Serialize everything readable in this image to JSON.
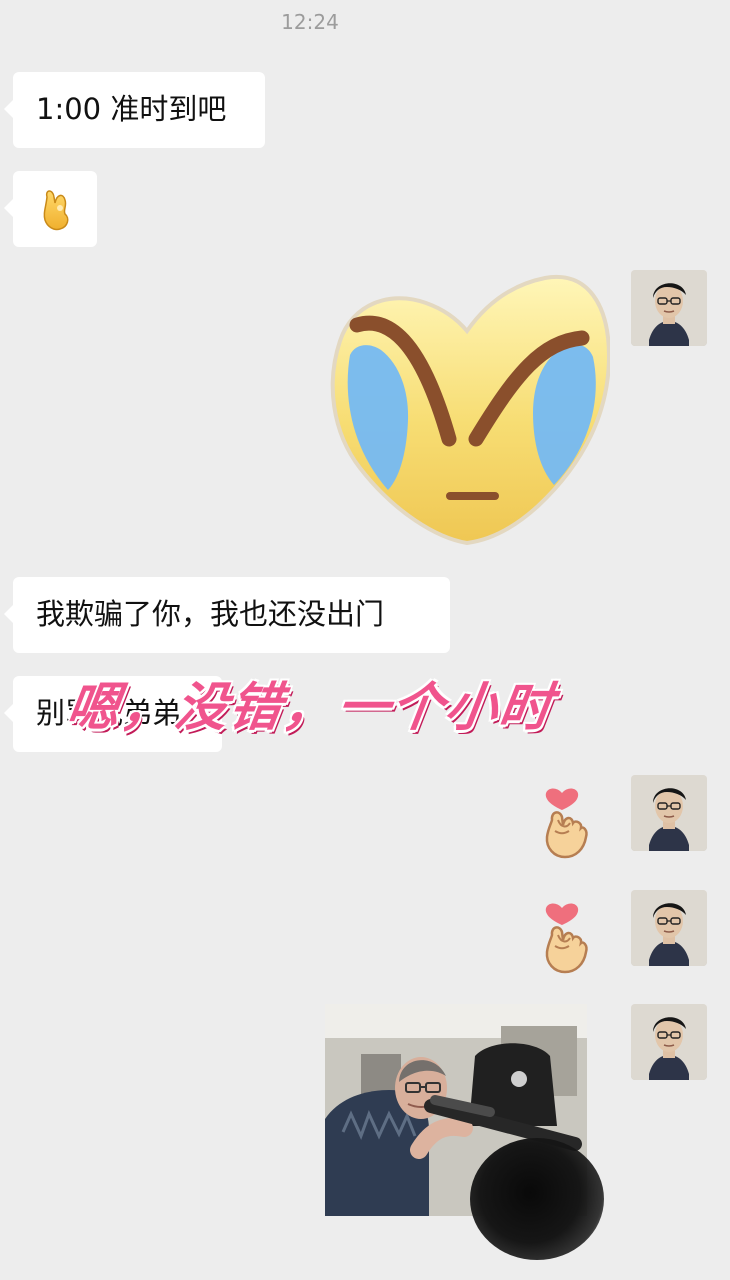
{
  "chat": {
    "timestamp": "12:24",
    "messages": [
      {
        "text": "1:00 准时到吧"
      },
      {
        "text": ""
      },
      {
        "text": "我欺骗了你，我也还没出门"
      },
      {
        "text": "别骂我弟弟"
      }
    ],
    "overlay_caption": "嗯，没错，一个小时"
  },
  "icons": {
    "message_2": "ok-hand-icon",
    "sticker_1": "crying-heart-face-sticker",
    "sticker_2": "finger-heart-icon",
    "sticker_3": "finger-heart-icon"
  },
  "colors": {
    "background": "#ededed",
    "bubble": "#ffffff",
    "caption": "#f0548d"
  }
}
